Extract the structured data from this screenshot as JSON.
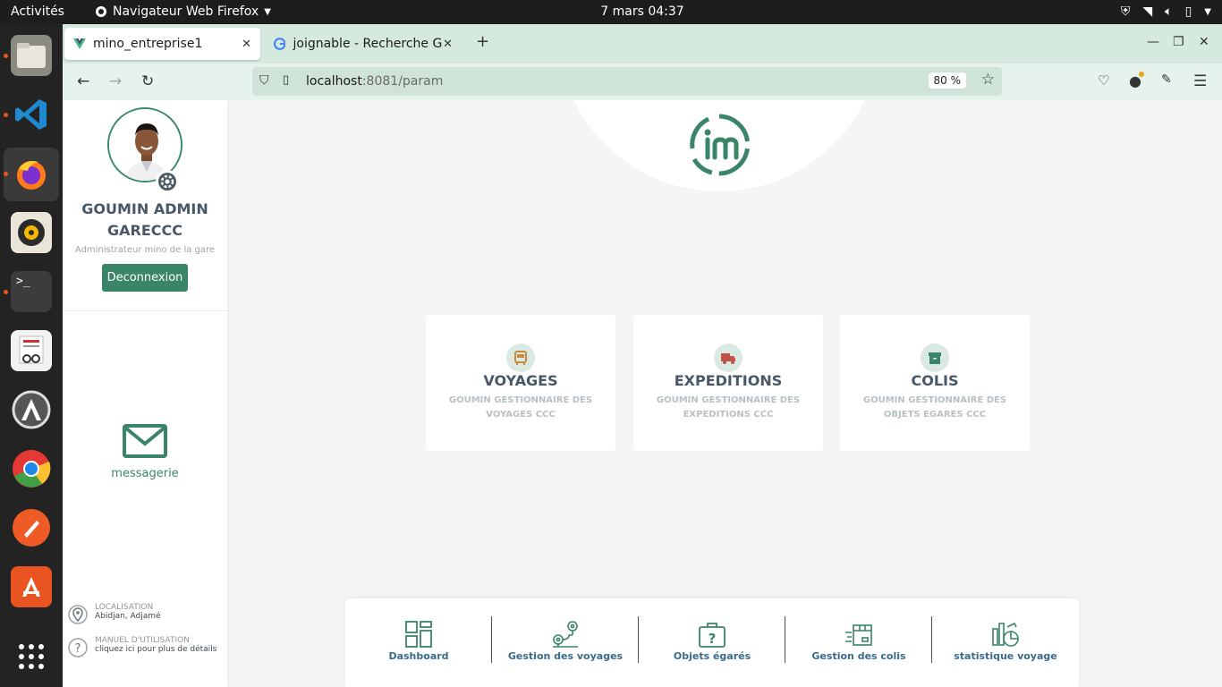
{
  "system": {
    "activities": "Activités",
    "app_name": "Navigateur Web Firefox",
    "clock": "7 mars  04:37"
  },
  "browser": {
    "tabs": [
      {
        "title": "mino_entreprise1",
        "active": true
      },
      {
        "title": "joignable - Recherche Go",
        "active": false
      }
    ],
    "url_host": "localhost",
    "url_rest": ":8081/param",
    "zoom": "80 %"
  },
  "sidebar": {
    "user_name_line1": "GOUMIN ADMIN",
    "user_name_line2": "GARECCC",
    "role": "Administrateur mino de la gare",
    "logout_label": "Deconnexion",
    "messaging_label": "messagerie",
    "location_title": "LOCALISATION",
    "location_value": "Abidjan, Adjamé",
    "manual_title": "MANUEL D'UTILISATION",
    "manual_value": "cliquez ici pour plus de détails"
  },
  "cards": [
    {
      "title": "VOYAGES",
      "sub": "GOUMIN GESTIONNAIRE DES VOYAGES CCC",
      "icon": "bus-icon",
      "icon_color": "#c98a3a"
    },
    {
      "title": "EXPEDITIONS",
      "sub": "GOUMIN GESTIONNAIRE DES EXPEDITIONS CCC",
      "icon": "truck-icon",
      "icon_color": "#c0524a"
    },
    {
      "title": "COLIS",
      "sub": "GOUMIN GESTIONNAIRE DES OBJETS EGARES CCC",
      "icon": "archive-icon",
      "icon_color": "#3a8468"
    }
  ],
  "bottom_nav": [
    {
      "label": "Dashboard",
      "icon": "dashboard-icon"
    },
    {
      "label": "Gestion des voyages",
      "icon": "route-icon"
    },
    {
      "label": "Objets égarés",
      "icon": "lost-briefcase-icon"
    },
    {
      "label": "Gestion des colis",
      "icon": "parcel-icon"
    },
    {
      "label": "statistique voyage",
      "icon": "stats-icon"
    }
  ],
  "colors": {
    "brand_green": "#3a8468",
    "text_slate": "#485867",
    "nav_blue": "#3a6b8a"
  }
}
